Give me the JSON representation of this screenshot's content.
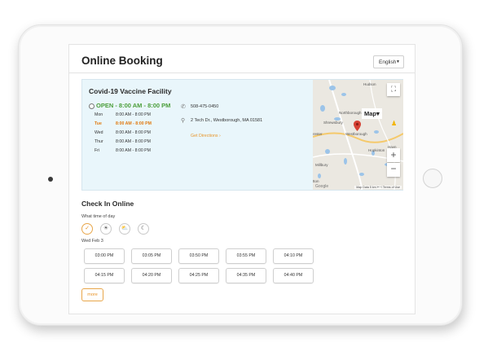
{
  "header": {
    "title": "Online Booking",
    "language": "English"
  },
  "facility": {
    "name": "Covid-19 Vaccine Facility",
    "status": "OPEN - 8:00 AM - 8:00 PM",
    "hours": [
      {
        "day": "Mon",
        "time": "8:00 AM - 8:00 PM",
        "today": false
      },
      {
        "day": "Tue",
        "time": "8:00 AM - 8:00 PM",
        "today": true
      },
      {
        "day": "Wed",
        "time": "8:00 AM - 8:00 PM",
        "today": false
      },
      {
        "day": "Thur",
        "time": "8:00 AM - 8:00 PM",
        "today": false
      },
      {
        "day": "Fri",
        "time": "8:00 AM - 8:00 PM",
        "today": false
      }
    ],
    "phone": "508-475-0450",
    "address": "2 Tech Dr., Westborough, MA 01581",
    "directions": "Get Directions ›"
  },
  "map": {
    "type_label": "Map",
    "places": [
      "Hudson",
      "Northborough",
      "Shrewsbury",
      "Westborough",
      "Hopkinton",
      "Millbury",
      "rester",
      "tton",
      "Hayn"
    ],
    "footer": "Map Data   5 km ⊢⊣   Terms of Use",
    "logo": "Google"
  },
  "checkin": {
    "title": "Check In Online",
    "time_label": "What time of day",
    "date": "Wed Feb 3",
    "slots": [
      "03:00 PM",
      "03:05 PM",
      "03:50 PM",
      "03:55 PM",
      "04:10 PM",
      "04:15 PM",
      "04:20 PM",
      "04:25 PM",
      "04:35 PM",
      "04:40 PM"
    ],
    "more": "more"
  },
  "icons": {
    "clock": "clock-icon",
    "phone": "phone-icon",
    "pin": "location-pin-icon",
    "time_of_day": [
      "all-day-icon",
      "morning-icon",
      "afternoon-icon",
      "night-icon"
    ]
  },
  "colors": {
    "open": "#4b9e3a",
    "accent": "#e8952a",
    "panel": "#e9f6fb"
  }
}
